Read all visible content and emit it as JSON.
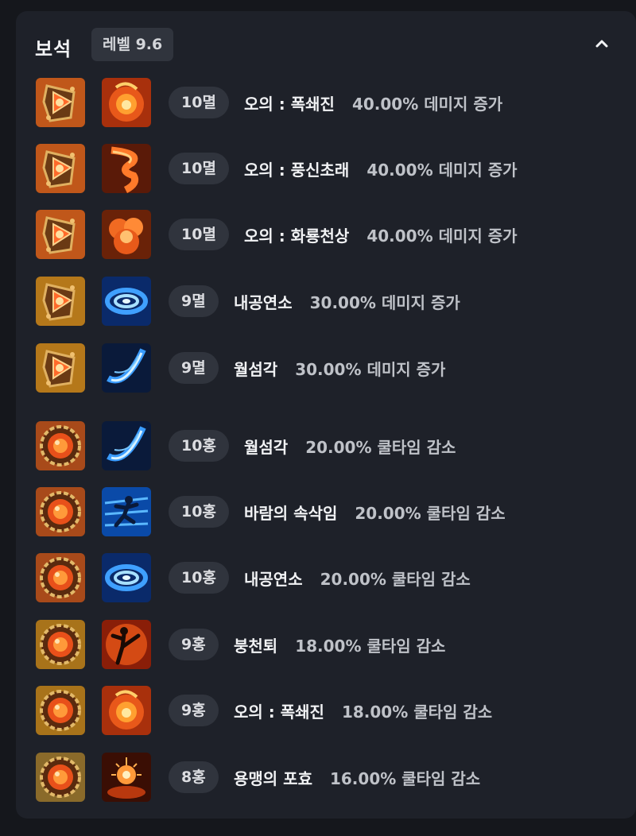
{
  "header": {
    "title": "보석",
    "level_label": "레벨 9.6",
    "collapse_icon": "chevron-up-icon"
  },
  "gems": [
    {
      "gem_type": "myeol",
      "gem_color": "#c0571a",
      "skill_icon": "fire-burst",
      "grade": "10멸",
      "skill": "오의 : 폭쇄진",
      "effect": "40.00% 데미지 증가"
    },
    {
      "gem_type": "myeol",
      "gem_color": "#c0571a",
      "skill_icon": "fire-tornado",
      "grade": "10멸",
      "skill": "오의 : 풍신초래",
      "effect": "40.00% 데미지 증가"
    },
    {
      "gem_type": "myeol",
      "gem_color": "#c0571a",
      "skill_icon": "fire-explosion",
      "grade": "10멸",
      "skill": "오의 : 화룡천상",
      "effect": "40.00% 데미지 증가"
    },
    {
      "gem_type": "myeol",
      "gem_color": "#b5781a",
      "skill_icon": "ice-vortex",
      "grade": "9멸",
      "skill": "내공연소",
      "effect": "30.00% 데미지 증가"
    },
    {
      "gem_type": "myeol",
      "gem_color": "#b5781a",
      "skill_icon": "ice-slash",
      "grade": "9멸",
      "skill": "월섬각",
      "effect": "30.00% 데미지 증가"
    },
    {
      "gem_type": "hong",
      "gem_color": "#a84a1a",
      "skill_icon": "ice-slash",
      "grade": "10홍",
      "skill": "월섬각",
      "effect": "20.00% 쿨타임 감소"
    },
    {
      "gem_type": "hong",
      "gem_color": "#a84a1a",
      "skill_icon": "wind-dash",
      "grade": "10홍",
      "skill": "바람의 속삭임",
      "effect": "20.00% 쿨타임 감소"
    },
    {
      "gem_type": "hong",
      "gem_color": "#a84a1a",
      "skill_icon": "ice-vortex",
      "grade": "10홍",
      "skill": "내공연소",
      "effect": "20.00% 쿨타임 감소"
    },
    {
      "gem_type": "hong",
      "gem_color": "#a8731a",
      "skill_icon": "fire-kick",
      "grade": "9홍",
      "skill": "붕천퇴",
      "effect": "18.00% 쿨타임 감소"
    },
    {
      "gem_type": "hong",
      "gem_color": "#a8731a",
      "skill_icon": "fire-burst",
      "grade": "9홍",
      "skill": "오의 : 폭쇄진",
      "effect": "18.00% 쿨타임 감소"
    },
    {
      "gem_type": "hong",
      "gem_color": "#8a6a2a",
      "skill_icon": "fire-roar",
      "grade": "8홍",
      "skill": "용맹의 포효",
      "effect": "16.00% 쿨타임 감소"
    }
  ]
}
